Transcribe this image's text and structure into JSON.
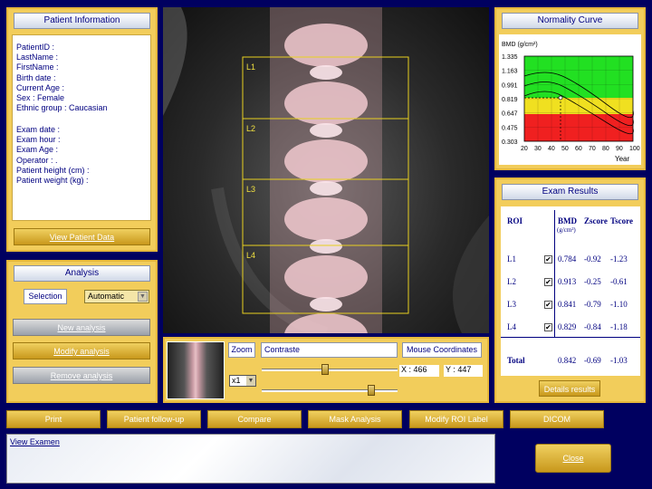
{
  "patient": {
    "title": "Patient Information",
    "fields": [
      "PatientID :",
      "LastName :",
      "FirstName :",
      "Birth date :",
      "Current Age :",
      "Sex : Female",
      "Ethnic group : Caucasian"
    ],
    "exam_fields": [
      "Exam date :",
      "Exam hour :",
      "Exam Age :",
      "Operator : .",
      "Patient height (cm) :",
      "Patient weight (kg) :"
    ],
    "view_button": "View Patient Data"
  },
  "analysis": {
    "title": "Analysis",
    "selection_label": "Selection",
    "selection_value": "Automatic",
    "new": "New analysis",
    "modify": "Modify analysis",
    "remove": "Remove analysis"
  },
  "scan": {
    "roi_labels": [
      "L1",
      "L2",
      "L3",
      "L4"
    ]
  },
  "controls": {
    "zoom": "Zoom",
    "zoom_value": "x1",
    "contrast": "Contraste",
    "mouse": "Mouse Coordinates",
    "x": "X : 466",
    "y": "Y : 447"
  },
  "curve": {
    "title": "Normality Curve",
    "ylabel": "BMD (g/cm²)",
    "xlabel": "Year",
    "y_ticks": [
      "1.335",
      "1.163",
      "0.991",
      "0.819",
      "0.647",
      "0.475",
      "0.303"
    ],
    "x_ticks": [
      "20",
      "30",
      "40",
      "50",
      "60",
      "70",
      "80",
      "90",
      "100"
    ]
  },
  "results": {
    "title": "Exam Results",
    "headers": [
      "ROI",
      "BMD",
      "Zscore",
      "Tscore"
    ],
    "bmd_unit": "(g/cm²)",
    "rows": [
      {
        "roi": "L1",
        "bmd": "0.784",
        "z": "-0.92",
        "t": "-1.23"
      },
      {
        "roi": "L2",
        "bmd": "0.913",
        "z": "-0.25",
        "t": "-0.61"
      },
      {
        "roi": "L3",
        "bmd": "0.841",
        "z": "-0.79",
        "t": "-1.10"
      },
      {
        "roi": "L4",
        "bmd": "0.829",
        "z": "-0.84",
        "t": "-1.18"
      }
    ],
    "total": {
      "roi": "Total",
      "bmd": "0.842",
      "z": "-0.69",
      "t": "-1.03"
    },
    "details": "Details results"
  },
  "toolbar": [
    "Print",
    "Patient follow-up",
    "Compare",
    "Mask Analysis",
    "Modify ROI Label",
    "DICOM"
  ],
  "footer": {
    "view_exam": "View Examen",
    "close": "Close"
  },
  "colors": {
    "background": "#000060",
    "panel": "#f2cd5b",
    "normal_green": "#22e022",
    "osteopenia_yellow": "#f0e020",
    "osteoporosis_red": "#f02020"
  }
}
